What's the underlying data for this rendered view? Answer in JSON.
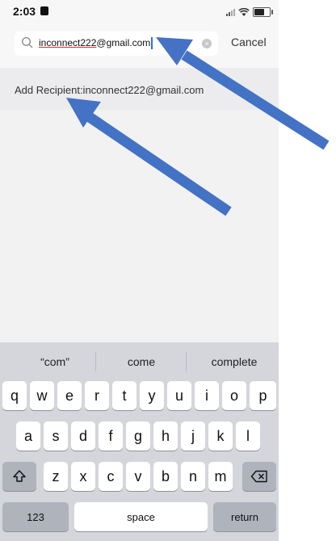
{
  "status_bar": {
    "time": "2:03"
  },
  "search": {
    "value_underlined": "inconnect222",
    "value_rest": "@gmail.com",
    "cancel_label": "Cancel"
  },
  "results": {
    "add_recipient": "Add Recipient:inconnect222@gmail.com"
  },
  "keyboard": {
    "suggestions": [
      "“com”",
      "come",
      "complete"
    ],
    "row1": [
      "q",
      "w",
      "e",
      "r",
      "t",
      "y",
      "u",
      "i",
      "o",
      "p"
    ],
    "row2": [
      "a",
      "s",
      "d",
      "f",
      "g",
      "h",
      "j",
      "k",
      "l"
    ],
    "row3": [
      "z",
      "x",
      "c",
      "v",
      "b",
      "n",
      "m"
    ],
    "numbers_label": "123",
    "space_label": "space",
    "return_label": "return"
  },
  "annotations": {
    "arrow_color": "#4472c4"
  }
}
